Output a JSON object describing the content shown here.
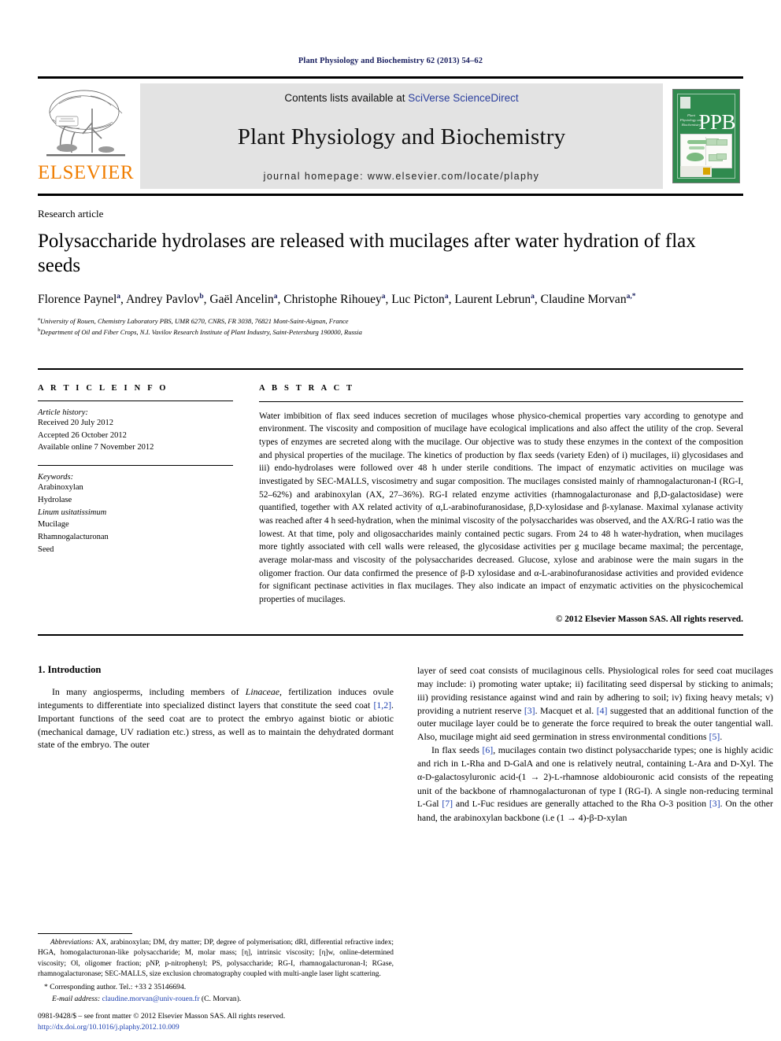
{
  "running_head": "Plant Physiology and Biochemistry 62 (2013) 54–62",
  "masthead": {
    "elsevier_wordmark": "ELSEVIER",
    "contents_prefix": "Contents lists available at ",
    "contents_link": "SciVerse ScienceDirect",
    "journal_name": "Plant Physiology and Biochemistry",
    "homepage": "journal homepage: www.elsevier.com/locate/plaphy",
    "cover": {
      "letters": "PPB",
      "title_small": "Plant Physiology and Biochemistry"
    },
    "accent_orange": "#f07d00",
    "link_blue": "#2b3f9e",
    "cover_green": "#2f8a4e"
  },
  "article": {
    "type": "Research article",
    "title": "Polysaccharide hydrolases are released with mucilages after water hydration of flax seeds",
    "authors": [
      {
        "name": "Florence Paynel",
        "sup": "a"
      },
      {
        "name": "Andrey Pavlov",
        "sup": "b"
      },
      {
        "name": "Gaël Ancelin",
        "sup": "a"
      },
      {
        "name": "Christophe Rihouey",
        "sup": "a"
      },
      {
        "name": "Luc Picton",
        "sup": "a"
      },
      {
        "name": "Laurent Lebrun",
        "sup": "a"
      },
      {
        "name": "Claudine Morvan",
        "sup": "a,*"
      }
    ],
    "affiliations": [
      {
        "sup": "a",
        "text": "University of Rouen, Chemistry Laboratory PBS, UMR 6270, CNRS, FR 3038, 76821 Mont-Saint-Aignan, France"
      },
      {
        "sup": "b",
        "text": "Department of Oil and Fiber Crops, N.I. Vavilov Research Institute of Plant Industry, Saint-Petersburg 190000, Russia"
      }
    ]
  },
  "article_info": {
    "heading": "A R T I C L E  I N F O",
    "history_label": "Article history:",
    "history": [
      "Received 20 July 2012",
      "Accepted 26 October 2012",
      "Available online 7 November 2012"
    ],
    "keywords_label": "Keywords:",
    "keywords": [
      "Arabinoxylan",
      "Hydrolase",
      "Linum usitatissimum",
      "Mucilage",
      "Rhamnogalacturonan",
      "Seed"
    ],
    "keyword_italic_index": 2
  },
  "abstract": {
    "heading": "A B S T R A C T",
    "body": "Water imbibition of flax seed induces secretion of mucilages whose physico-chemical properties vary according to genotype and environment. The viscosity and composition of mucilage have ecological implications and also affect the utility of the crop. Several types of enzymes are secreted along with the mucilage. Our objective was to study these enzymes in the context of the composition and physical properties of the mucilage. The kinetics of production by flax seeds (variety Eden) of i) mucilages, ii) glycosidases and iii) endo-hydrolases were followed over 48 h under sterile conditions. The impact of enzymatic activities on mucilage was investigated by SEC-MALLS, viscosimetry and sugar composition. The mucilages consisted mainly of rhamnogalacturonan-I (RG-I, 52–62%) and arabinoxylan (AX, 27–36%). RG-I related enzyme activities (rhamnogalacturonase and β,D-galactosidase) were quantified, together with AX related activity of α,L-arabinofuranosidase, β,D-xylosidase and β-xylanase. Maximal xylanase activity was reached after 4 h seed-hydration, when the minimal viscosity of the polysaccharides was observed, and the AX/RG-I ratio was the lowest. At that time, poly and oligosaccharides mainly contained pectic sugars. From 24 to 48 h water-hydration, when mucilages more tightly associated with cell walls were released, the glycosidase activities per g mucilage became maximal; the percentage, average molar-mass and viscosity of the polysaccharides decreased. Glucose, xylose and arabinose were the main sugars in the oligomer fraction. Our data confirmed the presence of β-D xylosidase and α-L-arabinofuranosidase activities and provided evidence for significant pectinase activities in flax mucilages. They also indicate an impact of enzymatic activities on the physicochemical properties of mucilages.",
    "copyright": "© 2012 Elsevier Masson SAS. All rights reserved."
  },
  "introduction": {
    "heading": "1.  Introduction",
    "left_paragraph": "In many angiosperms, including members of Linaceae, fertilization induces ovule integuments to differentiate into specialized distinct layers that constitute the seed coat [1,2]. Important functions of the seed coat are to protect the embryo against biotic or abiotic (mechanical damage, UV radiation etc.) stress, as well as to maintain the dehydrated dormant state of the embryo. The outer",
    "right_paragraph_1": "layer of seed coat consists of mucilaginous cells. Physiological roles for seed coat mucilages may include: i) promoting water uptake; ii) facilitating seed dispersal by sticking to animals; iii) providing resistance against wind and rain by adhering to soil; iv) fixing heavy metals; v) providing a nutrient reserve [3]. Macquet et al. [4] suggested that an additional function of the outer mucilage layer could be to generate the force required to break the outer tangential wall. Also, mucilage might aid seed germination in stress environmental conditions [5].",
    "right_paragraph_2": "In flax seeds [6], mucilages contain two distinct polysaccharide types; one is highly acidic and rich in L-Rha and D-GalA and one is relatively neutral, containing L-Ara and D-Xyl. The α-D-galactosyluronic acid-(1 → 2)-L-rhamnose aldobiouronic acid consists of the repeating unit of the backbone of rhamnogalacturonan of type I (RG-I). A single non-reducing terminal L-Gal [7] and L-Fuc residues are generally attached to the Rha O-3 position [3]. On the other hand, the arabinoxylan backbone (i.e (1 → 4)-β-D-xylan"
  },
  "footnotes": {
    "abbreviations_label": "Abbreviations:",
    "abbreviations_text": " AX, arabinoxylan; DM, dry matter; DP, degree of polymerisation; dRI, differential refractive index; HGA, homogalacturonan-like polysaccharide; M, molar mass; [η], intrinsic viscosity; [η]w, online-determined viscosity; Ol, oligomer fraction; pNP, p-nitrophenyl; PS, polysaccharide; RG-I, rhamnogalacturonan-I; RGase, rhamnogalacturonase; SEC-MALLS, size exclusion chromatography coupled with multi-angle laser light scattering.",
    "corresponding": "* Corresponding author. Tel.: +33 2 35146694.",
    "email_label": "E-mail address:",
    "email": "claudine.morvan@univ-rouen.fr",
    "email_suffix": " (C. Morvan)."
  },
  "issn_line": {
    "text": "0981-9428/$ – see front matter © 2012 Elsevier Masson SAS. All rights reserved.",
    "doi": "http://dx.doi.org/10.1016/j.plaphy.2012.10.009"
  }
}
